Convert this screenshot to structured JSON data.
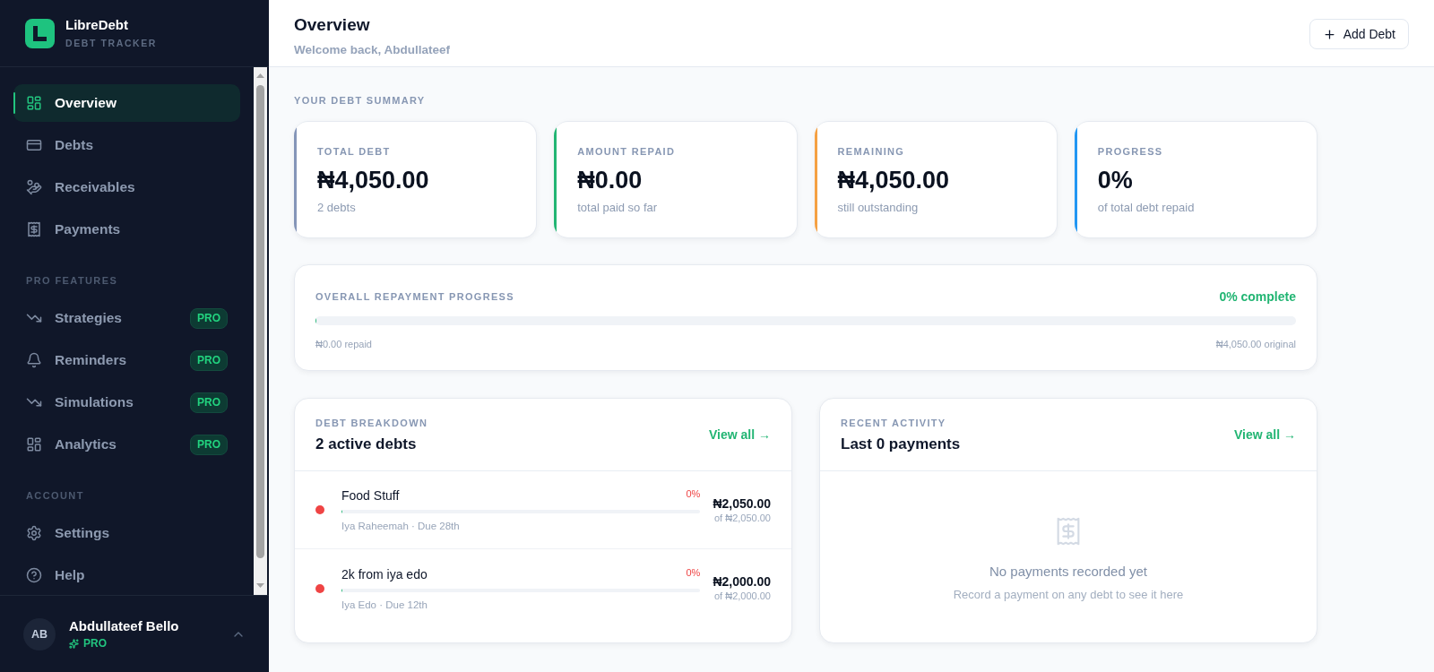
{
  "sidebar": {
    "brand": {
      "name": "LibreDebt",
      "tagline": "DEBT TRACKER"
    },
    "sections": [
      {
        "items": [
          {
            "label": "Overview",
            "selected": true
          },
          {
            "label": "Debts",
            "selected": false
          },
          {
            "label": "Receivables",
            "selected": false
          },
          {
            "label": "Payments",
            "selected": false
          }
        ]
      },
      {
        "title": "PRO FEATURES",
        "items": [
          {
            "label": "Strategies",
            "selected": false,
            "badge": "PRO"
          },
          {
            "label": "Reminders",
            "selected": false,
            "badge": "PRO"
          },
          {
            "label": "Simulations",
            "selected": false,
            "badge": "PRO"
          },
          {
            "label": "Analytics",
            "selected": false,
            "badge": "PRO"
          }
        ]
      },
      {
        "title": "ACCOUNT",
        "items": [
          {
            "label": "Settings",
            "selected": false
          },
          {
            "label": "Help",
            "selected": false
          }
        ]
      }
    ],
    "user": {
      "initials": "AB",
      "name": "Abdullateef Bello",
      "plan": "PRO"
    }
  },
  "header": {
    "title": "Overview",
    "subtitle": "Welcome back, Abdullateef",
    "action": "Add Debt"
  },
  "summary": {
    "title": "YOUR DEBT SUMMARY",
    "cards": [
      {
        "label": "TOTAL DEBT",
        "value": "₦4,050.00",
        "note": "2 debts",
        "color": "#8495b8"
      },
      {
        "label": "AMOUNT REPAID",
        "value": "₦0.00",
        "note": "total paid so far",
        "color": "#22b573"
      },
      {
        "label": "REMAINING",
        "value": "₦4,050.00",
        "note": "still outstanding",
        "color": "#f5a042"
      },
      {
        "label": "PROGRESS",
        "value": "0%",
        "note": "of total debt repaid",
        "color": "#2196f3"
      }
    ]
  },
  "repayment": {
    "title": "OVERALL REPAYMENT PROGRESS",
    "reading": "0% complete",
    "level": 0,
    "repaid": "₦0.00 repaid",
    "original": "₦4,050.00 original"
  },
  "debt_breakdown": {
    "label": "DEBT BREAKDOWN",
    "title": "2 active debts",
    "link": "View all →",
    "debts": [
      {
        "name": "Food Stuff",
        "percent": "0%",
        "level": 0,
        "meta": "Iya Raheemah · Due 28th",
        "amount": "₦2,050.00",
        "total": "of ₦2,050.00",
        "color": "#ef4444"
      },
      {
        "name": "2k from iya edo",
        "percent": "0%",
        "level": 0,
        "meta": "Iya Edo · Due 12th",
        "amount": "₦2,000.00",
        "total": "of ₦2,000.00",
        "color": "#ef4444"
      }
    ]
  },
  "recent_activity": {
    "label": "RECENT ACTIVITY",
    "title": "Last 0 payments",
    "link": "View all →",
    "empty_title": "No payments recorded yet",
    "empty_text": "Record a payment on any debt to see it here"
  }
}
